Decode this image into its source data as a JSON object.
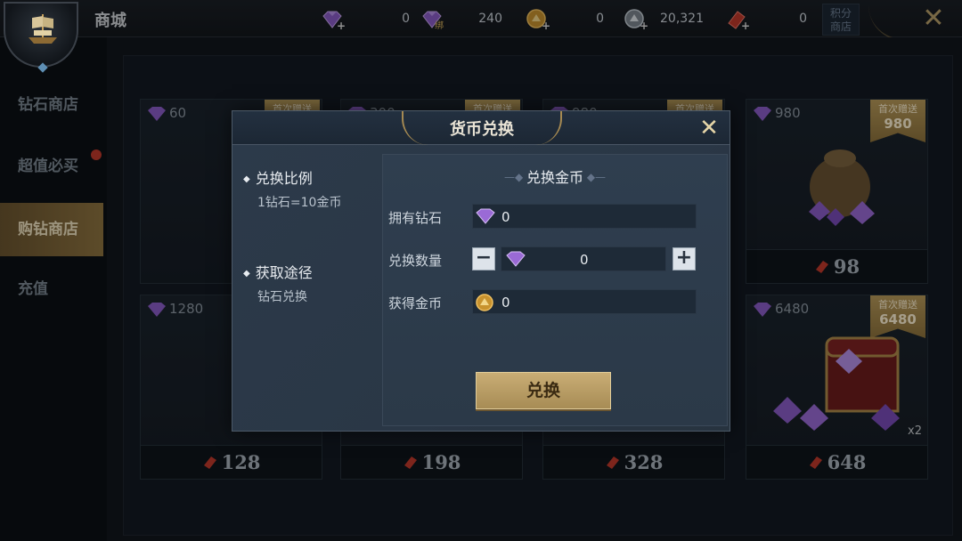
{
  "header": {
    "title": "商城",
    "points_shop_label": "积分\n商店",
    "currencies": [
      {
        "icon": "diamond-plus-icon",
        "amount": "0"
      },
      {
        "icon": "bound-diamond-icon",
        "amount": "240",
        "tag": "绑"
      },
      {
        "icon": "gold-coin-plus-icon",
        "amount": "0"
      },
      {
        "icon": "silver-coin-plus-icon",
        "amount": "20,321"
      },
      {
        "icon": "ruby-plus-icon",
        "amount": "0"
      }
    ]
  },
  "sidebar": {
    "items": [
      {
        "label": "钻石商店",
        "active": false
      },
      {
        "label": "超值必买",
        "active": false,
        "badge": true
      },
      {
        "label": "购钻商店",
        "active": true
      },
      {
        "label": "充值",
        "active": false
      }
    ]
  },
  "shop": {
    "cards": [
      {
        "amount": "60",
        "price": "",
        "ribbon_line1": "首次赠送",
        "ribbon_line2": ""
      },
      {
        "amount": "300",
        "price": "",
        "ribbon_line1": "首次赠送",
        "ribbon_line2": ""
      },
      {
        "amount": "980",
        "price": "",
        "ribbon_line1": "首次赠送",
        "ribbon_line2": ""
      },
      {
        "amount": "980",
        "price": "98",
        "ribbon_line1": "首次赠送",
        "ribbon_line2": "980"
      },
      {
        "amount": "1280",
        "price": "128"
      },
      {
        "amount": "",
        "price": "198"
      },
      {
        "amount": "",
        "price": "328"
      },
      {
        "amount": "6480",
        "price": "648",
        "ribbon_line1": "首次赠送",
        "ribbon_line2": "6480",
        "multiplier": "x2"
      }
    ]
  },
  "modal": {
    "title": "货币兑换",
    "rate_title": "兑换比例",
    "rate_text": "1钻石=10金币",
    "source_title": "获取途径",
    "source_text": "钻石兑换",
    "panel_title": "兑换金币",
    "own_label": "拥有钻石",
    "own_value": "0",
    "qty_label": "兑换数量",
    "qty_value": "0",
    "gain_label": "获得金币",
    "gain_value": "0",
    "confirm_label": "兑换"
  },
  "colors": {
    "accent_gold": "#a78c55",
    "diamond_purple": "#9a6ad6",
    "ruby_red": "#c0392b"
  }
}
